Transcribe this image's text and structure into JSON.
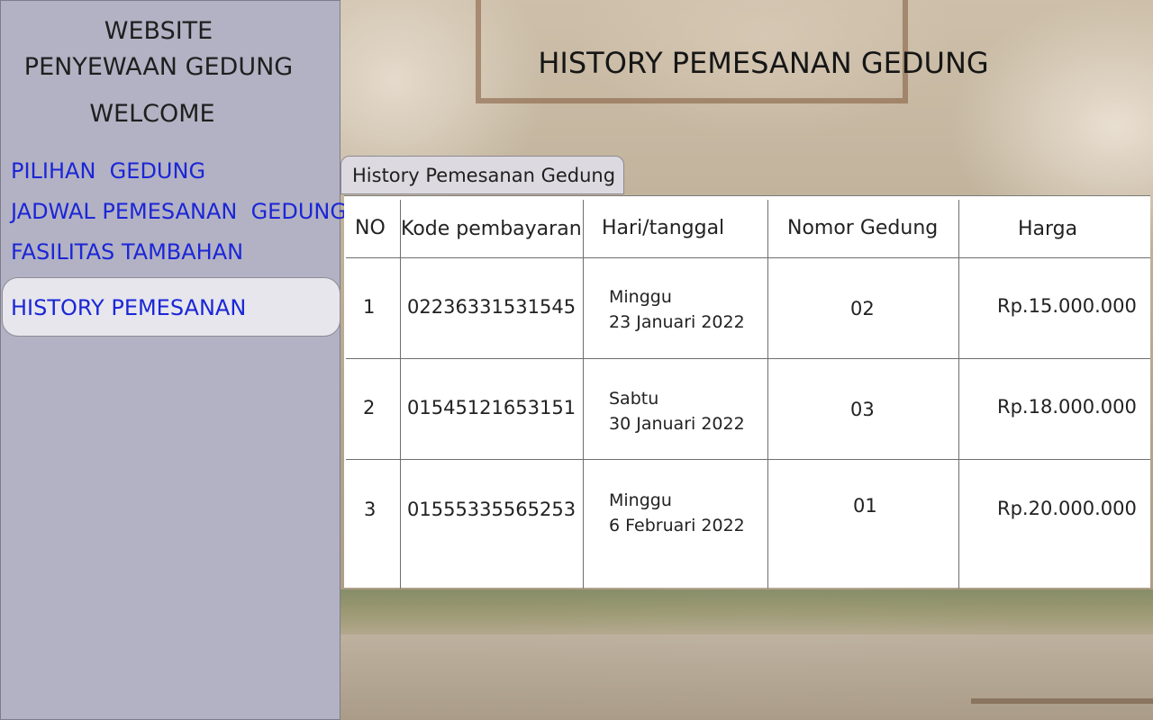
{
  "sidebar": {
    "site_title_line1": "WEBSITE",
    "site_title_line2": "PENYEWAAN GEDUNG",
    "welcome": "WELCOME",
    "nav": [
      {
        "label": "PILIHAN  GEDUNG"
      },
      {
        "label": "JADWAL PEMESANAN  GEDUNG"
      },
      {
        "label": "FASILITAS TAMBAHAN"
      },
      {
        "label": "HISTORY PEMESANAN",
        "active": true
      }
    ]
  },
  "main": {
    "title": "HISTORY PEMESANAN GEDUNG",
    "tab_label": "History Pemesanan Gedung",
    "table": {
      "columns": [
        "NO",
        "Kode pembayaran",
        "Hari/tanggal",
        "Nomor Gedung",
        "Harga"
      ],
      "rows": [
        {
          "no": "1",
          "kode": "02236331531545",
          "hari": "Minggu",
          "tanggal": "23 Januari 2022",
          "gedung": "02",
          "harga": "Rp.15.000.000"
        },
        {
          "no": "2",
          "kode": "01545121653151",
          "hari": "Sabtu",
          "tanggal": "30 Januari 2022",
          "gedung": "03",
          "harga": "Rp.18.000.000"
        },
        {
          "no": "3",
          "kode": "01555335565253",
          "hari": "Minggu",
          "tanggal": "6 Februari 2022",
          "gedung": "01",
          "harga": "Rp.20.000.000"
        }
      ]
    }
  },
  "colors": {
    "sidebar_bg": "#b3b2c4",
    "nav_link": "#1b26d6",
    "active_bg": "#e6e6ec"
  }
}
